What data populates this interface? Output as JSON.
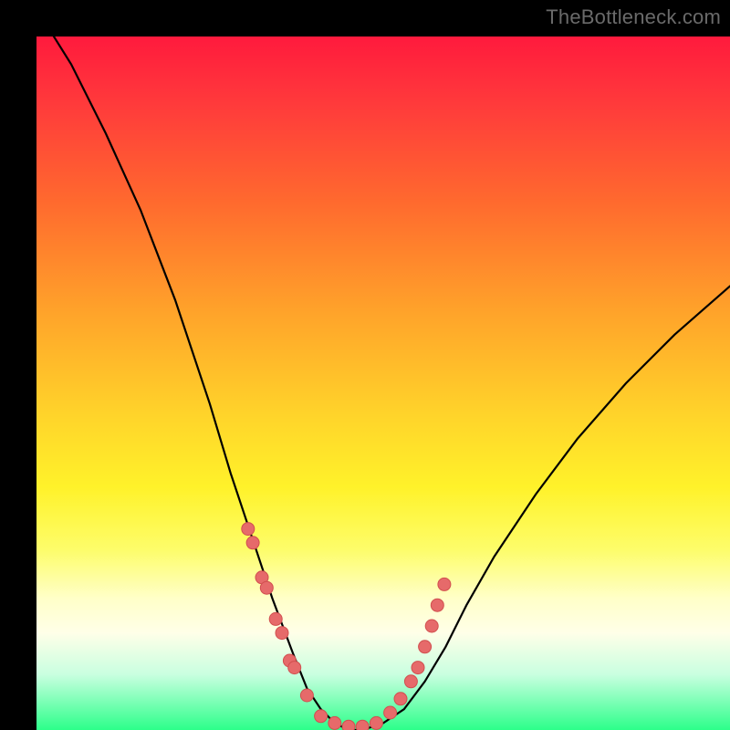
{
  "watermark": "TheBottleneck.com",
  "colors": {
    "frame": "#000000",
    "curve": "#000000",
    "dot_fill": "#e66a6a",
    "dot_stroke": "#d14f4f"
  },
  "chart_data": {
    "type": "line",
    "title": "",
    "xlabel": "",
    "ylabel": "",
    "xlim": [
      0,
      100
    ],
    "ylim": [
      0,
      100
    ],
    "grid": false,
    "legend": false,
    "series": [
      {
        "name": "bottleneck-curve",
        "x": [
          0,
          5,
          10,
          15,
          20,
          25,
          28,
          31,
          34,
          37,
          39,
          41,
          43,
          45,
          47,
          50,
          53,
          56,
          59,
          62,
          66,
          72,
          78,
          85,
          92,
          100
        ],
        "y": [
          104,
          96,
          86,
          75,
          62,
          47,
          37,
          28,
          19,
          11,
          6,
          3,
          1,
          0,
          0,
          1,
          3,
          7,
          12,
          18,
          25,
          34,
          42,
          50,
          57,
          64
        ]
      }
    ],
    "dots": {
      "name": "sample-points",
      "x": [
        30.5,
        31.2,
        32.5,
        33.2,
        34.5,
        35.4,
        36.5,
        37.2,
        39.0,
        41.0,
        43.0,
        45.0,
        47.0,
        49.0,
        51.0,
        52.5,
        54.0,
        55.0,
        56.0,
        57.0,
        57.8,
        58.8
      ],
      "y": [
        29.0,
        27.0,
        22.0,
        20.5,
        16.0,
        14.0,
        10.0,
        9.0,
        5.0,
        2.0,
        1.0,
        0.5,
        0.5,
        1.0,
        2.5,
        4.5,
        7.0,
        9.0,
        12.0,
        15.0,
        18.0,
        21.0
      ]
    }
  }
}
